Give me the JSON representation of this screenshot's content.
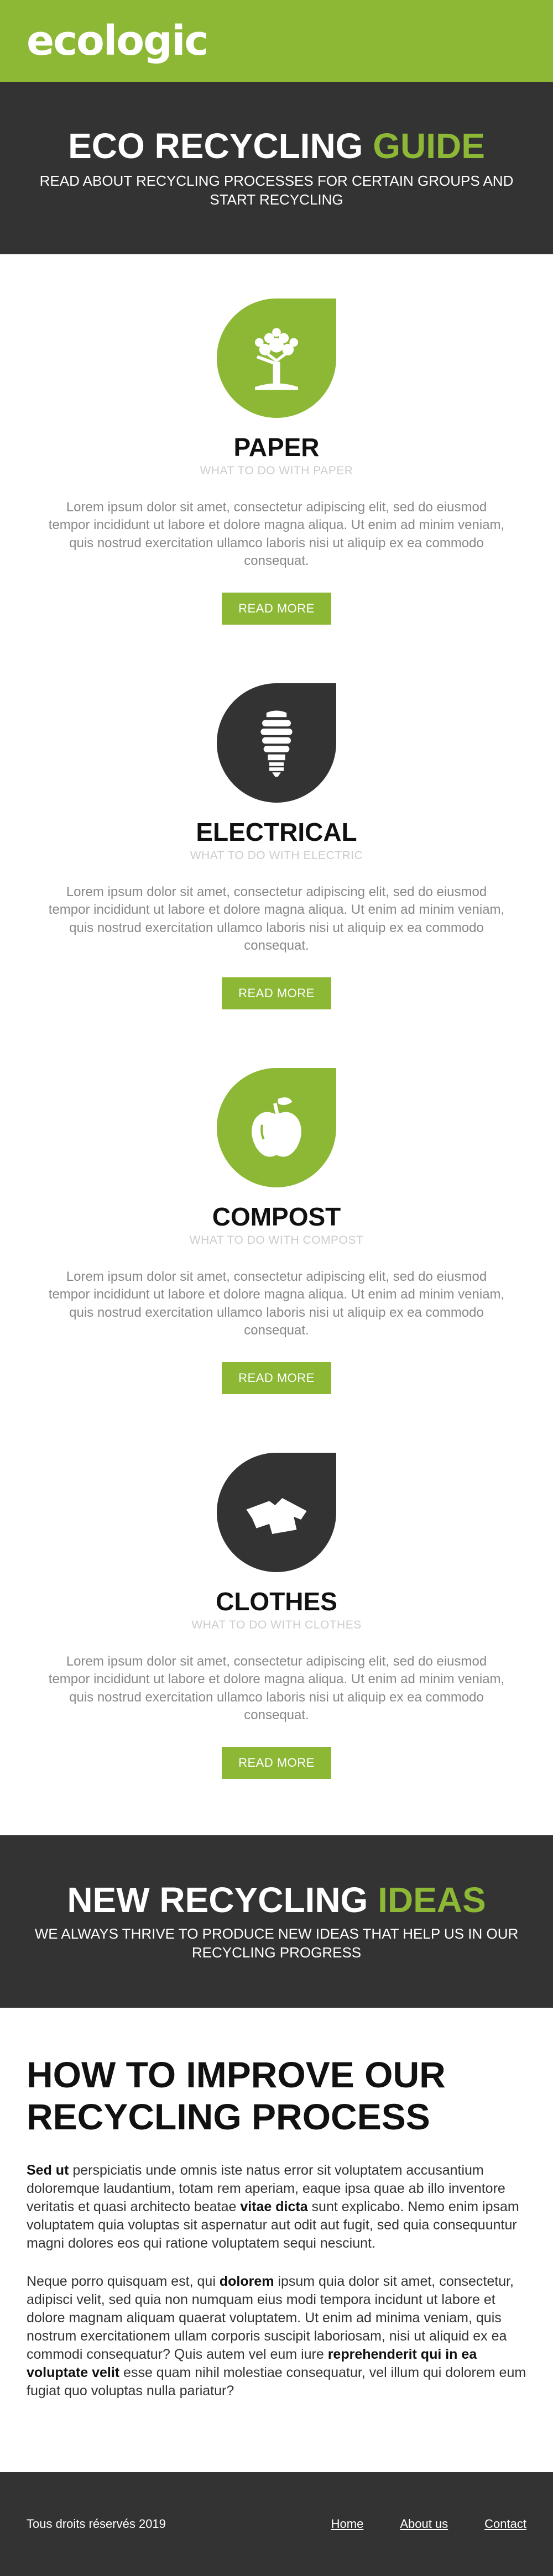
{
  "brand": {
    "logo_text": "ecologic",
    "accent_color": "#8cb836",
    "dark_color": "#333333"
  },
  "hero": {
    "title_main": "ECO RECYCLING ",
    "title_accent": "GUIDE",
    "subtitle": "READ ABOUT RECYCLING PROCESSES FOR CERTAIN GROUPS AND START RECYCLING"
  },
  "guide": {
    "cards": [
      {
        "title": "PAPER",
        "subtitle": "WHAT TO DO WITH PAPER",
        "body": "Lorem ipsum dolor sit amet, consectetur adipiscing elit, sed do eiusmod tempor incididunt ut labore et dolore magna aliqua. Ut enim ad minim veniam, quis nostrud exercitation ullamco laboris nisi ut aliquip ex ea commodo consequat.",
        "button": "READ MORE",
        "icon": "tree-icon",
        "icon_bg": "#8cb836"
      },
      {
        "title": "ELECTRICAL",
        "subtitle": "WHAT TO DO WITH ELECTRIC",
        "body": "Lorem ipsum dolor sit amet, consectetur adipiscing elit, sed do eiusmod tempor incididunt ut labore et dolore magna aliqua. Ut enim ad minim veniam, quis nostrud exercitation ullamco laboris nisi ut aliquip ex ea commodo consequat.",
        "button": "READ MORE",
        "icon": "lightbulb-icon",
        "icon_bg": "#333333"
      },
      {
        "title": "COMPOST",
        "subtitle": "WHAT TO DO WITH COMPOST",
        "body": "Lorem ipsum dolor sit amet, consectetur adipiscing elit, sed do eiusmod tempor incididunt ut labore et dolore magna aliqua. Ut enim ad minim veniam, quis nostrud exercitation ullamco laboris nisi ut aliquip ex ea commodo consequat.",
        "button": "READ MORE",
        "icon": "apple-icon",
        "icon_bg": "#8cb836"
      },
      {
        "title": "CLOTHES",
        "subtitle": "WHAT TO DO WITH CLOTHES",
        "body": "Lorem ipsum dolor sit amet, consectetur adipiscing elit, sed do eiusmod tempor incididunt ut labore et dolore magna aliqua. Ut enim ad minim veniam, quis nostrud exercitation ullamco laboris nisi ut aliquip ex ea commodo consequat.",
        "button": "READ MORE",
        "icon": "shirt-icon",
        "icon_bg": "#333333"
      }
    ]
  },
  "ideas": {
    "title_main": "NEW RECYCLING ",
    "title_accent": "IDEAS",
    "subtitle": "WE ALWAYS THRIVE TO PRODUCE NEW IDEAS THAT HELP US IN OUR RECYCLING PROGRESS"
  },
  "improve": {
    "title": "HOW TO IMPROVE OUR RECYCLING PROCESS",
    "p1": {
      "b1": "Sed ut",
      "t1": " perspiciatis unde omnis iste natus error sit voluptatem accusantium doloremque laudantium, totam rem aperiam, eaque ipsa quae ab illo inventore veritatis et quasi architecto beatae ",
      "b2": "vitae dicta",
      "t2": " sunt explicabo. Nemo enim ipsam voluptatem quia voluptas sit aspernatur aut odit aut fugit, sed quia consequuntur magni dolores eos qui ratione voluptatem sequi nesciunt."
    },
    "p2": {
      "t1": "Neque porro quisquam est, qui ",
      "b1": "dolorem",
      "t2": " ipsum quia dolor sit amet, consectetur, adipisci velit, sed quia non numquam eius modi tempora incidunt ut labore et dolore magnam aliquam quaerat voluptatem. Ut enim ad minima veniam, quis nostrum exercitationem ullam corporis suscipit laboriosam, nisi ut aliquid ex ea commodi consequatur? Quis autem vel eum iure ",
      "b2": "reprehenderit qui in ea voluptate velit",
      "t3": " esse quam nihil molestiae consequatur, vel illum qui dolorem eum fugiat quo voluptas nulla pariatur?"
    }
  },
  "footer": {
    "copyright": "Tous droits réservés 2019",
    "links": [
      "Home",
      "About us",
      "Contact"
    ]
  }
}
